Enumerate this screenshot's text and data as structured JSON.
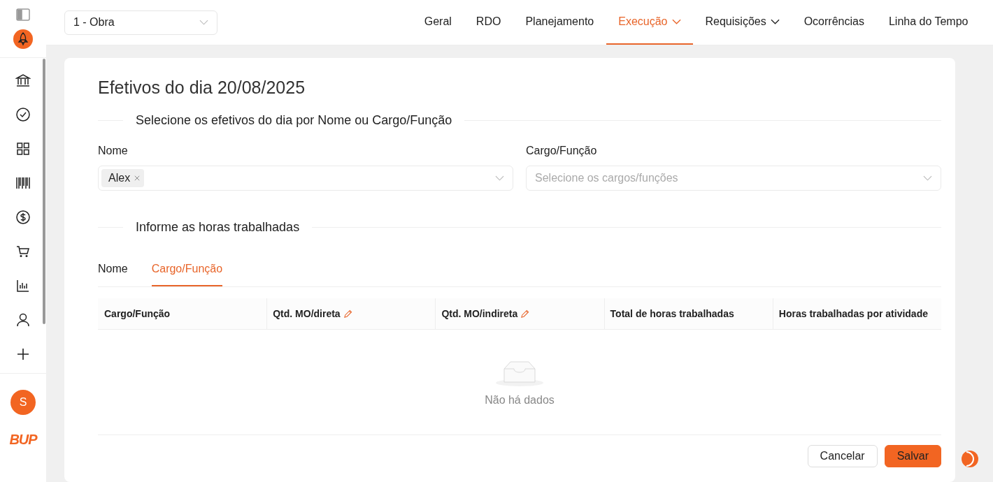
{
  "sidebar": {
    "avatar": "S",
    "logo": "BUP"
  },
  "project_select": {
    "value": "1 - Obra"
  },
  "nav": [
    {
      "label": "Geral",
      "selected": false,
      "has_menu": false
    },
    {
      "label": "RDO",
      "selected": false,
      "has_menu": false
    },
    {
      "label": "Planejamento",
      "selected": false,
      "has_menu": false
    },
    {
      "label": "Execução",
      "selected": true,
      "has_menu": true
    },
    {
      "label": "Requisições",
      "selected": false,
      "has_menu": true
    },
    {
      "label": "Ocorrências",
      "selected": false,
      "has_menu": false
    },
    {
      "label": "Linha do Tempo",
      "selected": false,
      "has_menu": false
    }
  ],
  "page_title": "Efetivos do dia 20/08/2025",
  "select_section": {
    "title": "Selecione os efetivos do dia por Nome ou Cargo/Função",
    "name_field": {
      "label": "Nome",
      "tags": [
        "Alex"
      ]
    },
    "role_field": {
      "label": "Cargo/Função",
      "placeholder": "Selecione os cargos/funções"
    }
  },
  "hours_section": {
    "title": "Informe as horas trabalhadas",
    "tabs": [
      {
        "label": "Nome",
        "selected": false
      },
      {
        "label": "Cargo/Função",
        "selected": true
      }
    ],
    "table": {
      "columns": [
        {
          "label": "Cargo/Função",
          "editable": false
        },
        {
          "label": "Qtd. MO/direta",
          "editable": true
        },
        {
          "label": "Qtd. MO/indireta",
          "editable": true
        },
        {
          "label": "Total de horas trabalhadas",
          "editable": false
        },
        {
          "label": "Horas trabalhadas por atividade",
          "editable": false
        }
      ],
      "empty_text": "Não há dados"
    }
  },
  "buttons": [
    {
      "label": "Cancelar",
      "kind": "secondary"
    },
    {
      "label": "Salvar",
      "kind": "primary"
    }
  ]
}
